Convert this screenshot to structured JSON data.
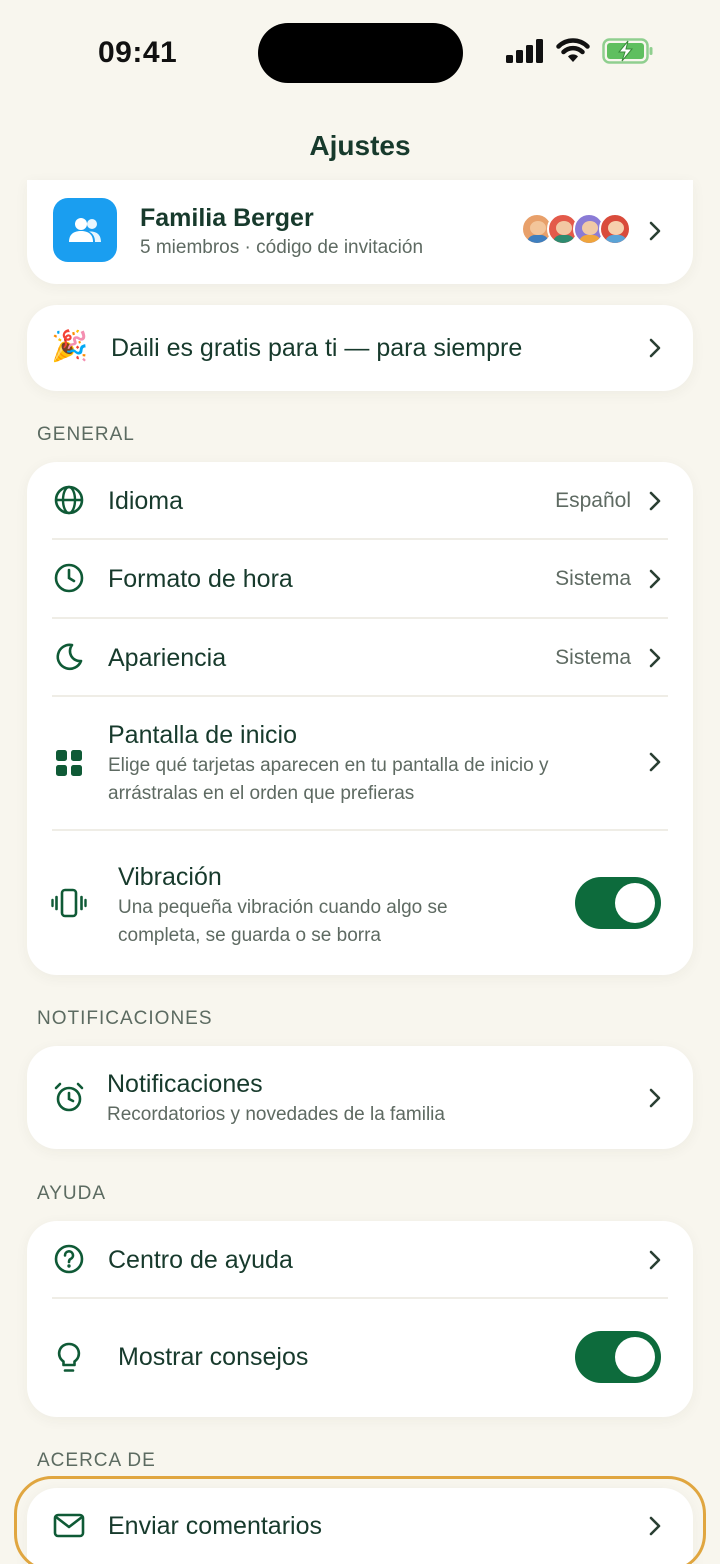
{
  "status_bar": {
    "time": "09:41"
  },
  "header": {
    "title": "Ajustes"
  },
  "family": {
    "name": "Familia Berger",
    "subtitle": "5 miembros · código de invitación"
  },
  "promo": {
    "label": "Daili es gratis para ti — para siempre",
    "emoji": "🎉"
  },
  "sections": {
    "general": "GENERAL",
    "notifications": "NOTIFICACIONES",
    "help": "AYUDA",
    "about": "ACERCA DE"
  },
  "general": {
    "language": {
      "label": "Idioma",
      "value": "Español"
    },
    "time_format": {
      "label": "Formato de hora",
      "value": "Sistema"
    },
    "appearance": {
      "label": "Apariencia",
      "value": "Sistema"
    },
    "home_screen": {
      "label": "Pantalla de inicio",
      "description": "Elige qué tarjetas aparecen en tu pantalla de inicio y arrástralas en el orden que prefieras"
    },
    "vibration": {
      "label": "Vibración",
      "description": "Una pequeña vibración cuando algo se completa, se guarda o se borra",
      "enabled": true
    }
  },
  "notifications": {
    "label": "Notificaciones",
    "description": "Recordatorios y novedades de la familia"
  },
  "help": {
    "help_center": {
      "label": "Centro de ayuda"
    },
    "show_tips": {
      "label": "Mostrar consejos",
      "enabled": true
    }
  },
  "about": {
    "feedback": {
      "label": "Enviar comentarios"
    }
  },
  "colors": {
    "accent": "#0d6b3c",
    "family_icon_bg": "#1a9ef0",
    "highlight": "#e0a640",
    "background": "#f8f6ee"
  }
}
